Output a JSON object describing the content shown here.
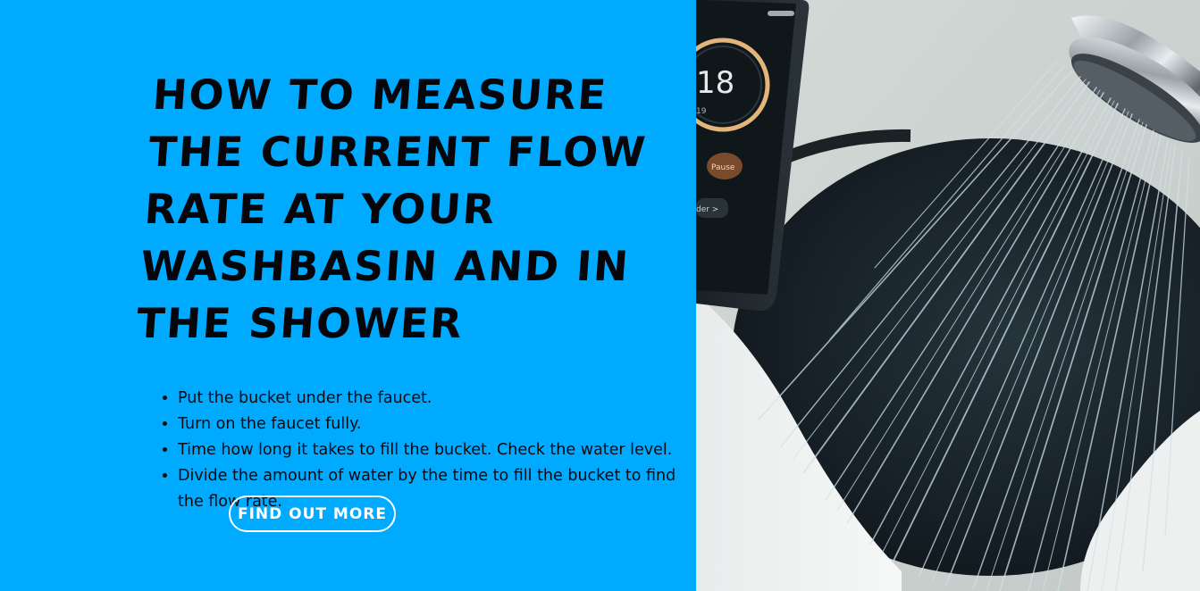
{
  "hero": {
    "heading": "How to measure the current flow rate at your washbasin and in the shower",
    "steps": [
      "Put the bucket under the faucet.",
      "Turn on the faucet fully.",
      "Time how long it takes to fill the bucket. Check the water level.",
      "Divide the amount of water by the time to fill the bucket to find the flow rate."
    ],
    "cta_label": "Find out more",
    "background_color": "#00aaff"
  },
  "photo": {
    "phone_time": "18",
    "phone_small_digits": "19",
    "phone_pause_label": "Pause",
    "phone_link_label": "der >"
  }
}
